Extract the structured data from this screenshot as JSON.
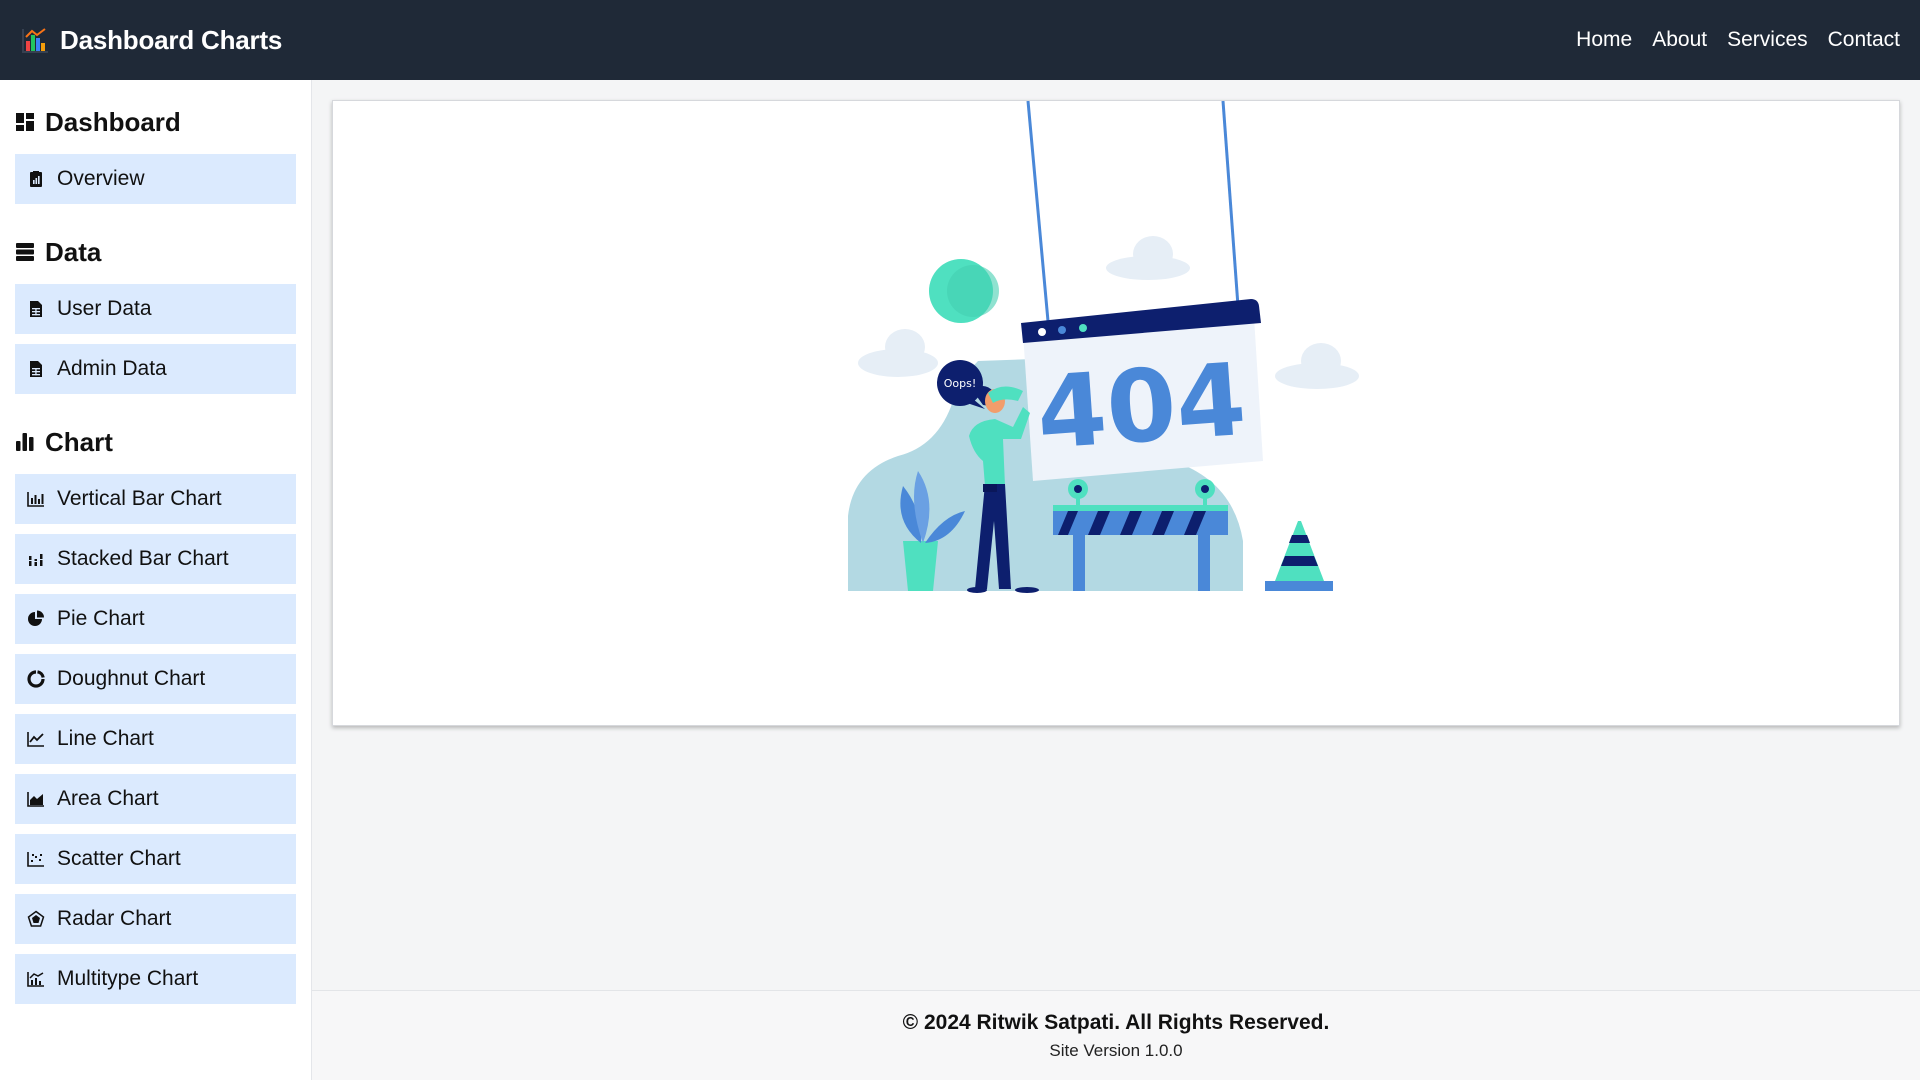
{
  "header": {
    "brand_title": "Dashboard Charts",
    "brand_icon": "bar-chart-logo-icon",
    "nav": [
      "Home",
      "About",
      "Services",
      "Contact"
    ]
  },
  "sidebar": {
    "sections": [
      {
        "title": "Dashboard",
        "icon": "dashboard-grid-icon",
        "items": [
          {
            "label": "Overview",
            "icon": "report-icon"
          }
        ]
      },
      {
        "title": "Data",
        "icon": "database-icon",
        "items": [
          {
            "label": "User Data",
            "icon": "sheet-icon"
          },
          {
            "label": "Admin Data",
            "icon": "sheet-icon"
          }
        ]
      },
      {
        "title": "Chart",
        "icon": "bar-chart-icon",
        "items": [
          {
            "label": "Vertical Bar Chart",
            "icon": "vertical-bar-icon"
          },
          {
            "label": "Stacked Bar Chart",
            "icon": "stacked-bar-icon"
          },
          {
            "label": "Pie Chart",
            "icon": "pie-icon"
          },
          {
            "label": "Doughnut Chart",
            "icon": "doughnut-icon"
          },
          {
            "label": "Line Chart",
            "icon": "line-icon"
          },
          {
            "label": "Area Chart",
            "icon": "area-icon"
          },
          {
            "label": "Scatter Chart",
            "icon": "scatter-icon"
          },
          {
            "label": "Radar Chart",
            "icon": "radar-icon"
          },
          {
            "label": "Multitype Chart",
            "icon": "multitype-icon"
          }
        ]
      }
    ]
  },
  "main": {
    "illustration": {
      "code": "404",
      "speech": "Oops!"
    }
  },
  "footer": {
    "copyright": "© 2024 Ritwik Satpati. All Rights Reserved.",
    "version": "Site Version 1.0.0"
  },
  "colors": {
    "topbar_bg": "#1f2937",
    "sidebar_item_bg": "#dbeafe",
    "illustration_blue": "#4a88d8",
    "illustration_navy": "#0d1f6e",
    "illustration_teal": "#4fe0c0",
    "illustration_light": "#b3d9e3"
  }
}
